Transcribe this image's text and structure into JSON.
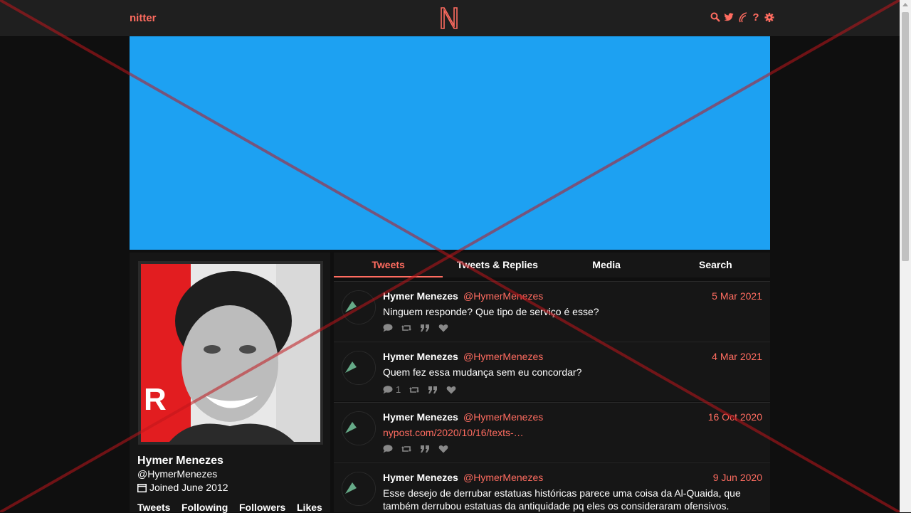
{
  "nav": {
    "brand": "nitter",
    "icons": [
      "search-icon",
      "twitter-bird-icon",
      "rss-icon",
      "help-icon",
      "settings-gear-icon"
    ],
    "help_glyph": "?"
  },
  "profile": {
    "fullname": "Hymer Menezes",
    "username": "@HymerMenezes",
    "joined": "Joined June 2012",
    "stats": {
      "tweets": "Tweets",
      "following": "Following",
      "followers": "Followers",
      "likes": "Likes"
    }
  },
  "tabs": [
    "Tweets",
    "Tweets & Replies",
    "Media",
    "Search"
  ],
  "tweets": [
    {
      "name": "Hymer Menezes",
      "handle": "@HymerMenezes",
      "date": "5 Mar 2021",
      "text": "Ninguem responde? Que tipo de serviço é esse?",
      "link": "",
      "replies": "",
      "retweets": "",
      "quotes": "",
      "likes": ""
    },
    {
      "name": "Hymer Menezes",
      "handle": "@HymerMenezes",
      "date": "4 Mar 2021",
      "text": "Quem fez essa mudança sem eu concordar?",
      "link": "",
      "replies": "1",
      "retweets": "",
      "quotes": "",
      "likes": ""
    },
    {
      "name": "Hymer Menezes",
      "handle": "@HymerMenezes",
      "date": "16 Oct 2020",
      "text": "",
      "link": "nypost.com/2020/10/16/texts-…",
      "replies": "",
      "retweets": "",
      "quotes": "",
      "likes": ""
    },
    {
      "name": "Hymer Menezes",
      "handle": "@HymerMenezes",
      "date": "9 Jun 2020",
      "text": "Esse desejo de derrubar estatuas históricas parece uma coisa da Al-Quaida, que também derrubou estatuas da antiquidade pq eles os consideraram ofensivos.",
      "link": "",
      "replies": "",
      "retweets": "",
      "quotes": "",
      "likes": ""
    }
  ],
  "colors": {
    "accent": "#ff6c60",
    "banner": "#1da1f2",
    "background": "#0f0f0f",
    "panel": "#161616"
  }
}
